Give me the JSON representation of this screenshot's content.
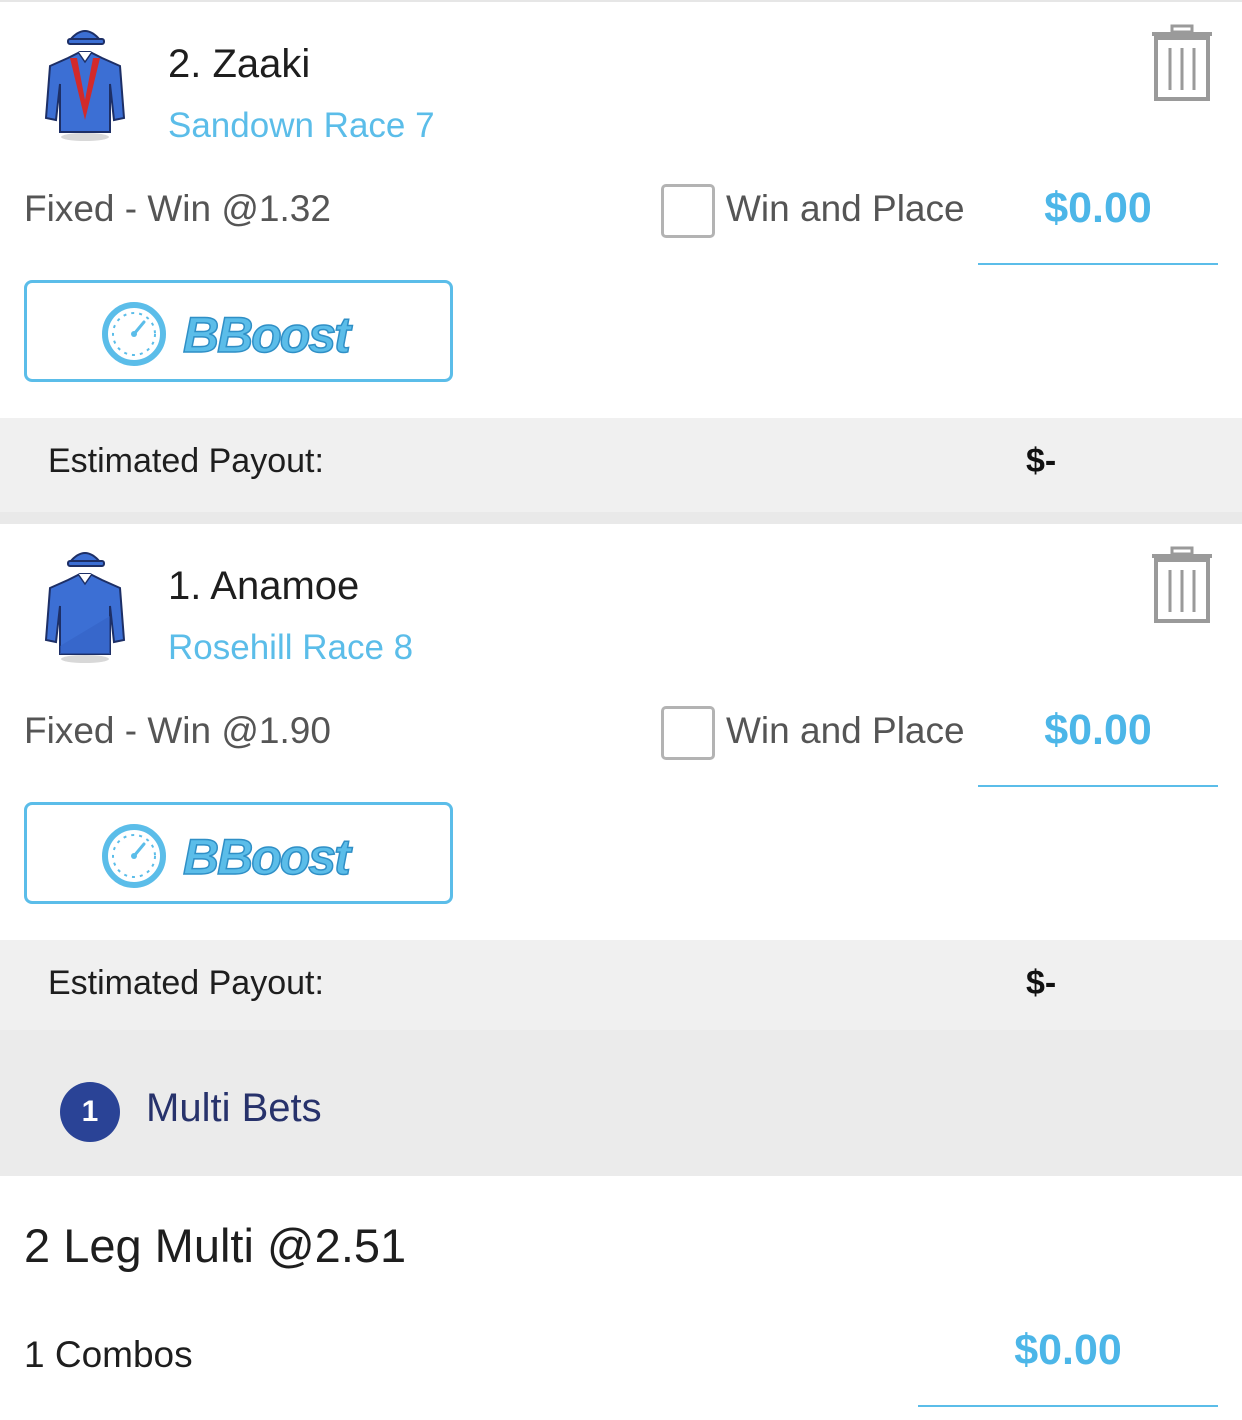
{
  "bets": [
    {
      "runner": "2. Zaaki",
      "race": "Sandown Race 7",
      "bet_type": "Fixed - Win @1.32",
      "win_place_label": "Win and Place",
      "win_place_checked": false,
      "stake": "$0.00",
      "boost_label": "BBoost",
      "payout_label": "Estimated Payout:",
      "payout_value": "$-",
      "silk_colors": {
        "body": "#3c6fd4",
        "trim": "#d22a2a",
        "cap": "#3c6fd4"
      }
    },
    {
      "runner": "1. Anamoe",
      "race": "Rosehill Race 8",
      "bet_type": "Fixed - Win @1.90",
      "win_place_label": "Win and Place",
      "win_place_checked": false,
      "stake": "$0.00",
      "boost_label": "BBoost",
      "payout_label": "Estimated Payout:",
      "payout_value": "$-",
      "silk_colors": {
        "body": "#3c6fd4",
        "trim": "#3c6fd4",
        "cap": "#3c6fd4"
      }
    }
  ],
  "multi": {
    "count": "1",
    "title": "Multi Bets",
    "leg_text": "2 Leg Multi @2.51",
    "combos": "1 Combos",
    "stake": "$0.00"
  },
  "colors": {
    "accent": "#5bbde9",
    "stake_text": "#4cb6e8",
    "badge": "#2a4396",
    "multi_title": "#27326b"
  },
  "icons": [
    "jockey-silk-icon",
    "trash-icon",
    "speedometer-icon"
  ]
}
